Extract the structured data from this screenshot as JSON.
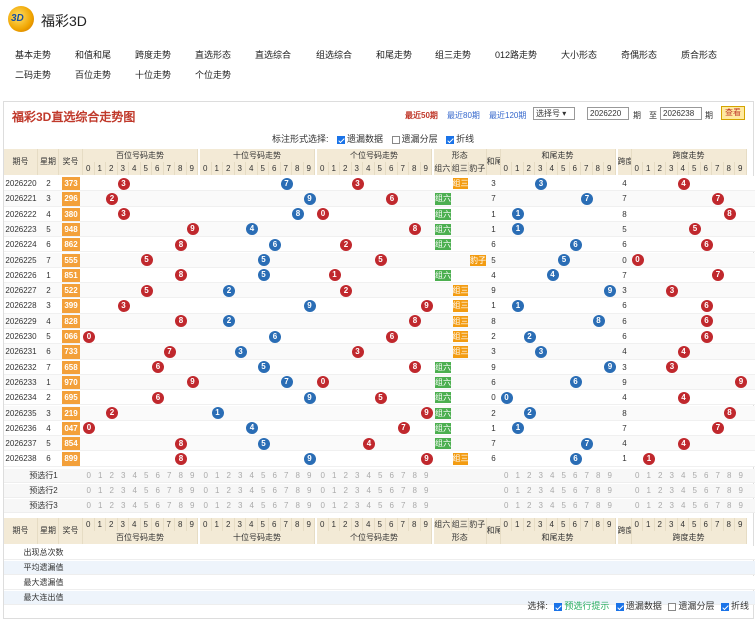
{
  "app": {
    "title": "福彩3D",
    "logo_text": "3D"
  },
  "nav": {
    "items": [
      "基本走势",
      "和值和尾",
      "跨度走势",
      "直选形态",
      "直选综合",
      "组选综合",
      "和尾走势",
      "组三走势",
      "012路走势",
      "大小形态",
      "奇偶形态",
      "质合形态",
      "二码走势",
      "百位走势",
      "十位走势",
      "个位走势"
    ]
  },
  "panel": {
    "title": "福彩3D直选综合走势图",
    "period_links": [
      "最近50期",
      "最近80期",
      "最近120期"
    ],
    "select_label": "选择号",
    "from_issue": "2026220",
    "to_issue": "2026238",
    "label_qi": "期",
    "label_zhi": "至",
    "query": "查看"
  },
  "mark_options": {
    "label": "标注形式选择:",
    "items": [
      {
        "label": "遗漏数据",
        "checked": true
      },
      {
        "label": "遗漏分层",
        "checked": false
      },
      {
        "label": "折线",
        "checked": true
      }
    ]
  },
  "table": {
    "headers": {
      "issue": "期号",
      "draw": "星期",
      "number": "奖号",
      "bai": "百位号码走势",
      "shi": "十位号码走势",
      "ge": "个位号码走势",
      "shape": "形态",
      "shape_cols": [
        "组六",
        "组三",
        "豹子"
      ],
      "hewei": "和尾",
      "hezhi": "和尾走势",
      "kuadu": "跨度",
      "kuadu_trend": "跨度走势",
      "digits": [
        "0",
        "1",
        "2",
        "3",
        "4",
        "5",
        "6",
        "7",
        "8",
        "9"
      ]
    },
    "rows": [
      {
        "issue": "2026220",
        "wd": "2",
        "num": "373",
        "b": 3,
        "s": 7,
        "g": 3,
        "shape": "组三",
        "hw": "3",
        "kd": "4"
      },
      {
        "issue": "2026221",
        "wd": "3",
        "num": "296",
        "b": 2,
        "s": 9,
        "g": 6,
        "shape": "组六",
        "hw": "7",
        "kd": "7"
      },
      {
        "issue": "2026222",
        "wd": "4",
        "num": "380",
        "b": 3,
        "s": 8,
        "g": 0,
        "shape": "组六",
        "hw": "1",
        "kd": "8"
      },
      {
        "issue": "2026223",
        "wd": "5",
        "num": "948",
        "b": 9,
        "s": 4,
        "g": 8,
        "shape": "组六",
        "hw": "1",
        "kd": "5"
      },
      {
        "issue": "2026224",
        "wd": "6",
        "num": "862",
        "b": 8,
        "s": 6,
        "g": 2,
        "shape": "组六",
        "hw": "6",
        "kd": "6"
      },
      {
        "issue": "2026225",
        "wd": "7",
        "num": "555",
        "b": 5,
        "s": 5,
        "g": 5,
        "shape": "豹子",
        "hw": "5",
        "kd": "0"
      },
      {
        "issue": "2026226",
        "wd": "1",
        "num": "851",
        "b": 8,
        "s": 5,
        "g": 1,
        "shape": "组六",
        "hw": "4",
        "kd": "7"
      },
      {
        "issue": "2026227",
        "wd": "2",
        "num": "522",
        "b": 5,
        "s": 2,
        "g": 2,
        "shape": "组三",
        "hw": "9",
        "kd": "3"
      },
      {
        "issue": "2026228",
        "wd": "3",
        "num": "399",
        "b": 3,
        "s": 9,
        "g": 9,
        "shape": "组三",
        "hw": "1",
        "kd": "6"
      },
      {
        "issue": "2026229",
        "wd": "4",
        "num": "828",
        "b": 8,
        "s": 2,
        "g": 8,
        "shape": "组三",
        "hw": "8",
        "kd": "6"
      },
      {
        "issue": "2026230",
        "wd": "5",
        "num": "066",
        "b": 0,
        "s": 6,
        "g": 6,
        "shape": "组三",
        "hw": "2",
        "kd": "6"
      },
      {
        "issue": "2026231",
        "wd": "6",
        "num": "733",
        "b": 7,
        "s": 3,
        "g": 3,
        "shape": "组三",
        "hw": "3",
        "kd": "4"
      },
      {
        "issue": "2026232",
        "wd": "7",
        "num": "658",
        "b": 6,
        "s": 5,
        "g": 8,
        "shape": "组六",
        "hw": "9",
        "kd": "3"
      },
      {
        "issue": "2026233",
        "wd": "1",
        "num": "970",
        "b": 9,
        "s": 7,
        "g": 0,
        "shape": "组六",
        "hw": "6",
        "kd": "9"
      },
      {
        "issue": "2026234",
        "wd": "2",
        "num": "695",
        "b": 6,
        "s": 9,
        "g": 5,
        "shape": "组六",
        "hw": "0",
        "kd": "4"
      },
      {
        "issue": "2026235",
        "wd": "3",
        "num": "219",
        "b": 2,
        "s": 1,
        "g": 9,
        "shape": "组六",
        "hw": "2",
        "kd": "8"
      },
      {
        "issue": "2026236",
        "wd": "4",
        "num": "047",
        "b": 0,
        "s": 4,
        "g": 7,
        "shape": "组六",
        "hw": "1",
        "kd": "7"
      },
      {
        "issue": "2026237",
        "wd": "5",
        "num": "854",
        "b": 8,
        "s": 5,
        "g": 4,
        "shape": "组六",
        "hw": "7",
        "kd": "4"
      },
      {
        "issue": "2026238",
        "wd": "6",
        "num": "899",
        "b": 8,
        "s": 9,
        "g": 9,
        "shape": "组三",
        "hw": "6",
        "kd": "1"
      }
    ],
    "preselect": [
      "预选行1",
      "预选行2",
      "预选行3"
    ],
    "footer_headers": {
      "issue": "期号",
      "wd": "星期",
      "num": "奖号"
    },
    "stats": [
      {
        "label": "出现总次数"
      },
      {
        "label": "平均遗漏值"
      },
      {
        "label": "最大遗漏值"
      },
      {
        "label": "最大连出值"
      }
    ]
  },
  "bottom_options": {
    "label": "选择:",
    "items": [
      {
        "label": "预选行提示",
        "checked": true
      },
      {
        "label": "遗漏数据",
        "checked": true
      },
      {
        "label": "遗漏分层",
        "checked": false
      },
      {
        "label": "折线",
        "checked": true
      }
    ]
  },
  "colors": {
    "red_ball": "#c0282d",
    "blue_ball": "#2a6db5",
    "header_bg": "#f3ead6",
    "title": "#c0392b"
  }
}
